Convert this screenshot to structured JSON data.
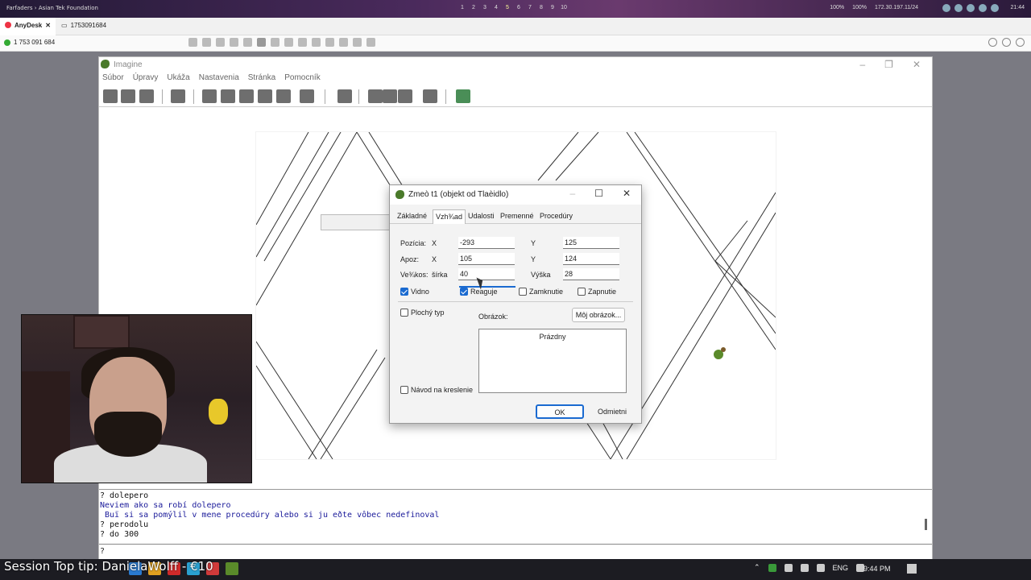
{
  "host": {
    "left_text": "Farfaders › Asian Tek Foundation",
    "workspaces": [
      "1",
      "2",
      "3",
      "4",
      "5",
      "6",
      "7",
      "8",
      "9",
      "10"
    ],
    "status": [
      "100%",
      "100%",
      "172.30.197.11/24"
    ],
    "clock": "21:44"
  },
  "anydesk": {
    "tab1": "AnyDesk",
    "tab2": "1753091684",
    "address": "1 753 091 684"
  },
  "imagine": {
    "title": "Imagine",
    "menu": [
      "Súbor",
      "Úpravy",
      "Ukáža",
      "Nastavenia",
      "Stránka",
      "Pomocník"
    ]
  },
  "dialog": {
    "title": "Zmeò t1 (objekt od Tlaèidlo)",
    "tabs": [
      "Základné",
      "Vzh¾ad",
      "Udalosti",
      "Premenné",
      "Procedúry"
    ],
    "active_tab": "Vzh¾ad",
    "pozicia_label": "Pozícia:",
    "apoz_label": "Apoz:",
    "velkost_label": "Ve¾kos: ",
    "x_label": "X",
    "y_label": "Y",
    "sirka_label": "šírka",
    "vyska_label": "Výška",
    "pozicia_x": "-293",
    "pozicia_y": "125",
    "apoz_x": "105",
    "apoz_y": "124",
    "sirka": "40",
    "vyska": "28",
    "checks": {
      "vidno": {
        "label": "Vidno",
        "checked": true
      },
      "reaguje": {
        "label": "Reaguje",
        "checked": true
      },
      "zamknutie": {
        "label": "Zamknutie",
        "checked": false
      },
      "zapnutie": {
        "label": "Zapnutie",
        "checked": false
      },
      "plochy": {
        "label": "Plochý typ",
        "checked": false
      },
      "navod": {
        "label": "Návod na kreslenie",
        "checked": false
      }
    },
    "obrazok_label": "Obrázok:",
    "moj_obrazok": "Môj obrázok...",
    "prazdny": "Prázdny",
    "ok": "OK",
    "cancel": "Odmietni"
  },
  "console": {
    "lines": [
      {
        "text": "? dolepero",
        "color": "black"
      },
      {
        "text": "Neviem ako sa robí dolepero",
        "color": "blue"
      },
      {
        "text": " Buï si sa pomýlil v mene procedúry alebo si ju eðte vôbec nedefinoval",
        "color": "blue"
      },
      {
        "text": "? perodolu",
        "color": "black"
      },
      {
        "text": "? do 300",
        "color": "black"
      }
    ],
    "prompt": "?"
  },
  "taskbar": {
    "tip": "Session Top tip: DanielaWolff - €10",
    "lang": "ENG",
    "time": "9:44 PM"
  },
  "colors": {
    "accent": "#1a6ad0",
    "console_blue": "#1a1a9a"
  }
}
